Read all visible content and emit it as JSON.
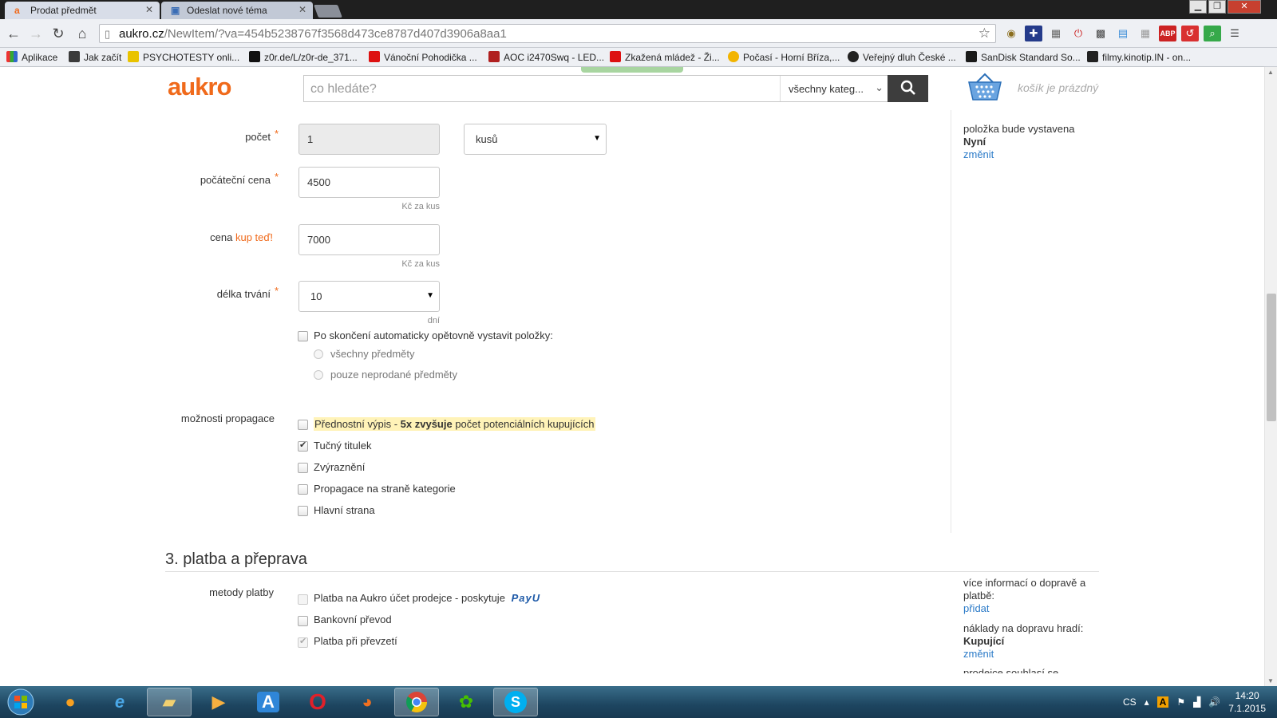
{
  "browser": {
    "tabs": [
      {
        "title": "Prodat předmět",
        "active": true,
        "favicon": "aukro-favicon"
      },
      {
        "title": "Odeslat nové téma",
        "active": false,
        "favicon": "forum-favicon"
      }
    ],
    "url_host": "aukro.cz",
    "url_path": "/NewItem/?va=454b5238767f3568d473ce8787d407d3906a8aa1",
    "bookmarks": [
      "Aplikace",
      "Jak začít",
      "PSYCHOTESTY onli...",
      "z0r.de/L/z0r-de_371...",
      "Vánoční Pohodička ...",
      "AOC i2470Swq - LED...",
      "Zkažená mládež - Ži...",
      "Počasí - Horní Bříza,...",
      "Veřejný dluh České ...",
      "SanDisk Standard So...",
      "filmy.kinotip.IN - on..."
    ]
  },
  "header": {
    "logo": "aukro",
    "search_placeholder": "co hledáte?",
    "category": "všechny kateg...",
    "cart": "košík je prázdný"
  },
  "form": {
    "count": {
      "label": "počet",
      "value": "1",
      "unit_select": "kusů"
    },
    "start_price": {
      "label": "počáteční cena",
      "value": "4500",
      "unit": "Kč za kus"
    },
    "buy_now": {
      "label_prefix": "cena ",
      "label_accent": "kup teď!",
      "value": "7000",
      "unit": "Kč za kus"
    },
    "duration": {
      "label": "délka trvání",
      "value": "10",
      "unit": "dní"
    },
    "relist": {
      "label": "Po skončení automaticky opětovně vystavit položky:",
      "options": [
        "všechny předměty",
        "pouze neprodané předměty"
      ]
    },
    "promo": {
      "label": "možnosti propagace",
      "featured_a": "Přednostní výpis",
      "featured_b": " - ",
      "featured_c": "5x zvyšuje",
      "featured_d": " počet potenciálních kupujících",
      "options": [
        {
          "label": "Tučný titulek",
          "checked": true
        },
        {
          "label": "Zvýraznění",
          "checked": false
        },
        {
          "label": "Propagace na straně kategorie",
          "checked": false
        },
        {
          "label": "Hlavní strana",
          "checked": false
        }
      ]
    },
    "section3_title": "3. platba a přeprava",
    "payment": {
      "label": "metody platby",
      "options": [
        {
          "label": "Platba na Aukro účet prodejce - poskytuje",
          "checked": false,
          "disabled": true
        },
        {
          "label": "Bankovní převod",
          "checked": false,
          "disabled": false
        },
        {
          "label": "Platba při převzetí",
          "checked": true,
          "disabled": true
        }
      ],
      "provider": "PayU"
    }
  },
  "sidebar": {
    "listing_when_label": "položka bude vystavena",
    "listing_when_value": "Nyní",
    "change": "změnit",
    "shipping_info_label": "více informací o dopravě a platbě:",
    "add": "přidat",
    "shipping_payer_label": "náklady na dopravu hradí:",
    "shipping_payer_value": "Kupující",
    "change2": "změnit",
    "truncated": "prodejce souhlasí se"
  },
  "taskbar": {
    "lang": "CS",
    "time": "14:20",
    "date": "7.1.2015"
  },
  "colors": {
    "accent": "#f06a1b",
    "link": "#2c7bc8",
    "highlight": "#fff3b8"
  }
}
